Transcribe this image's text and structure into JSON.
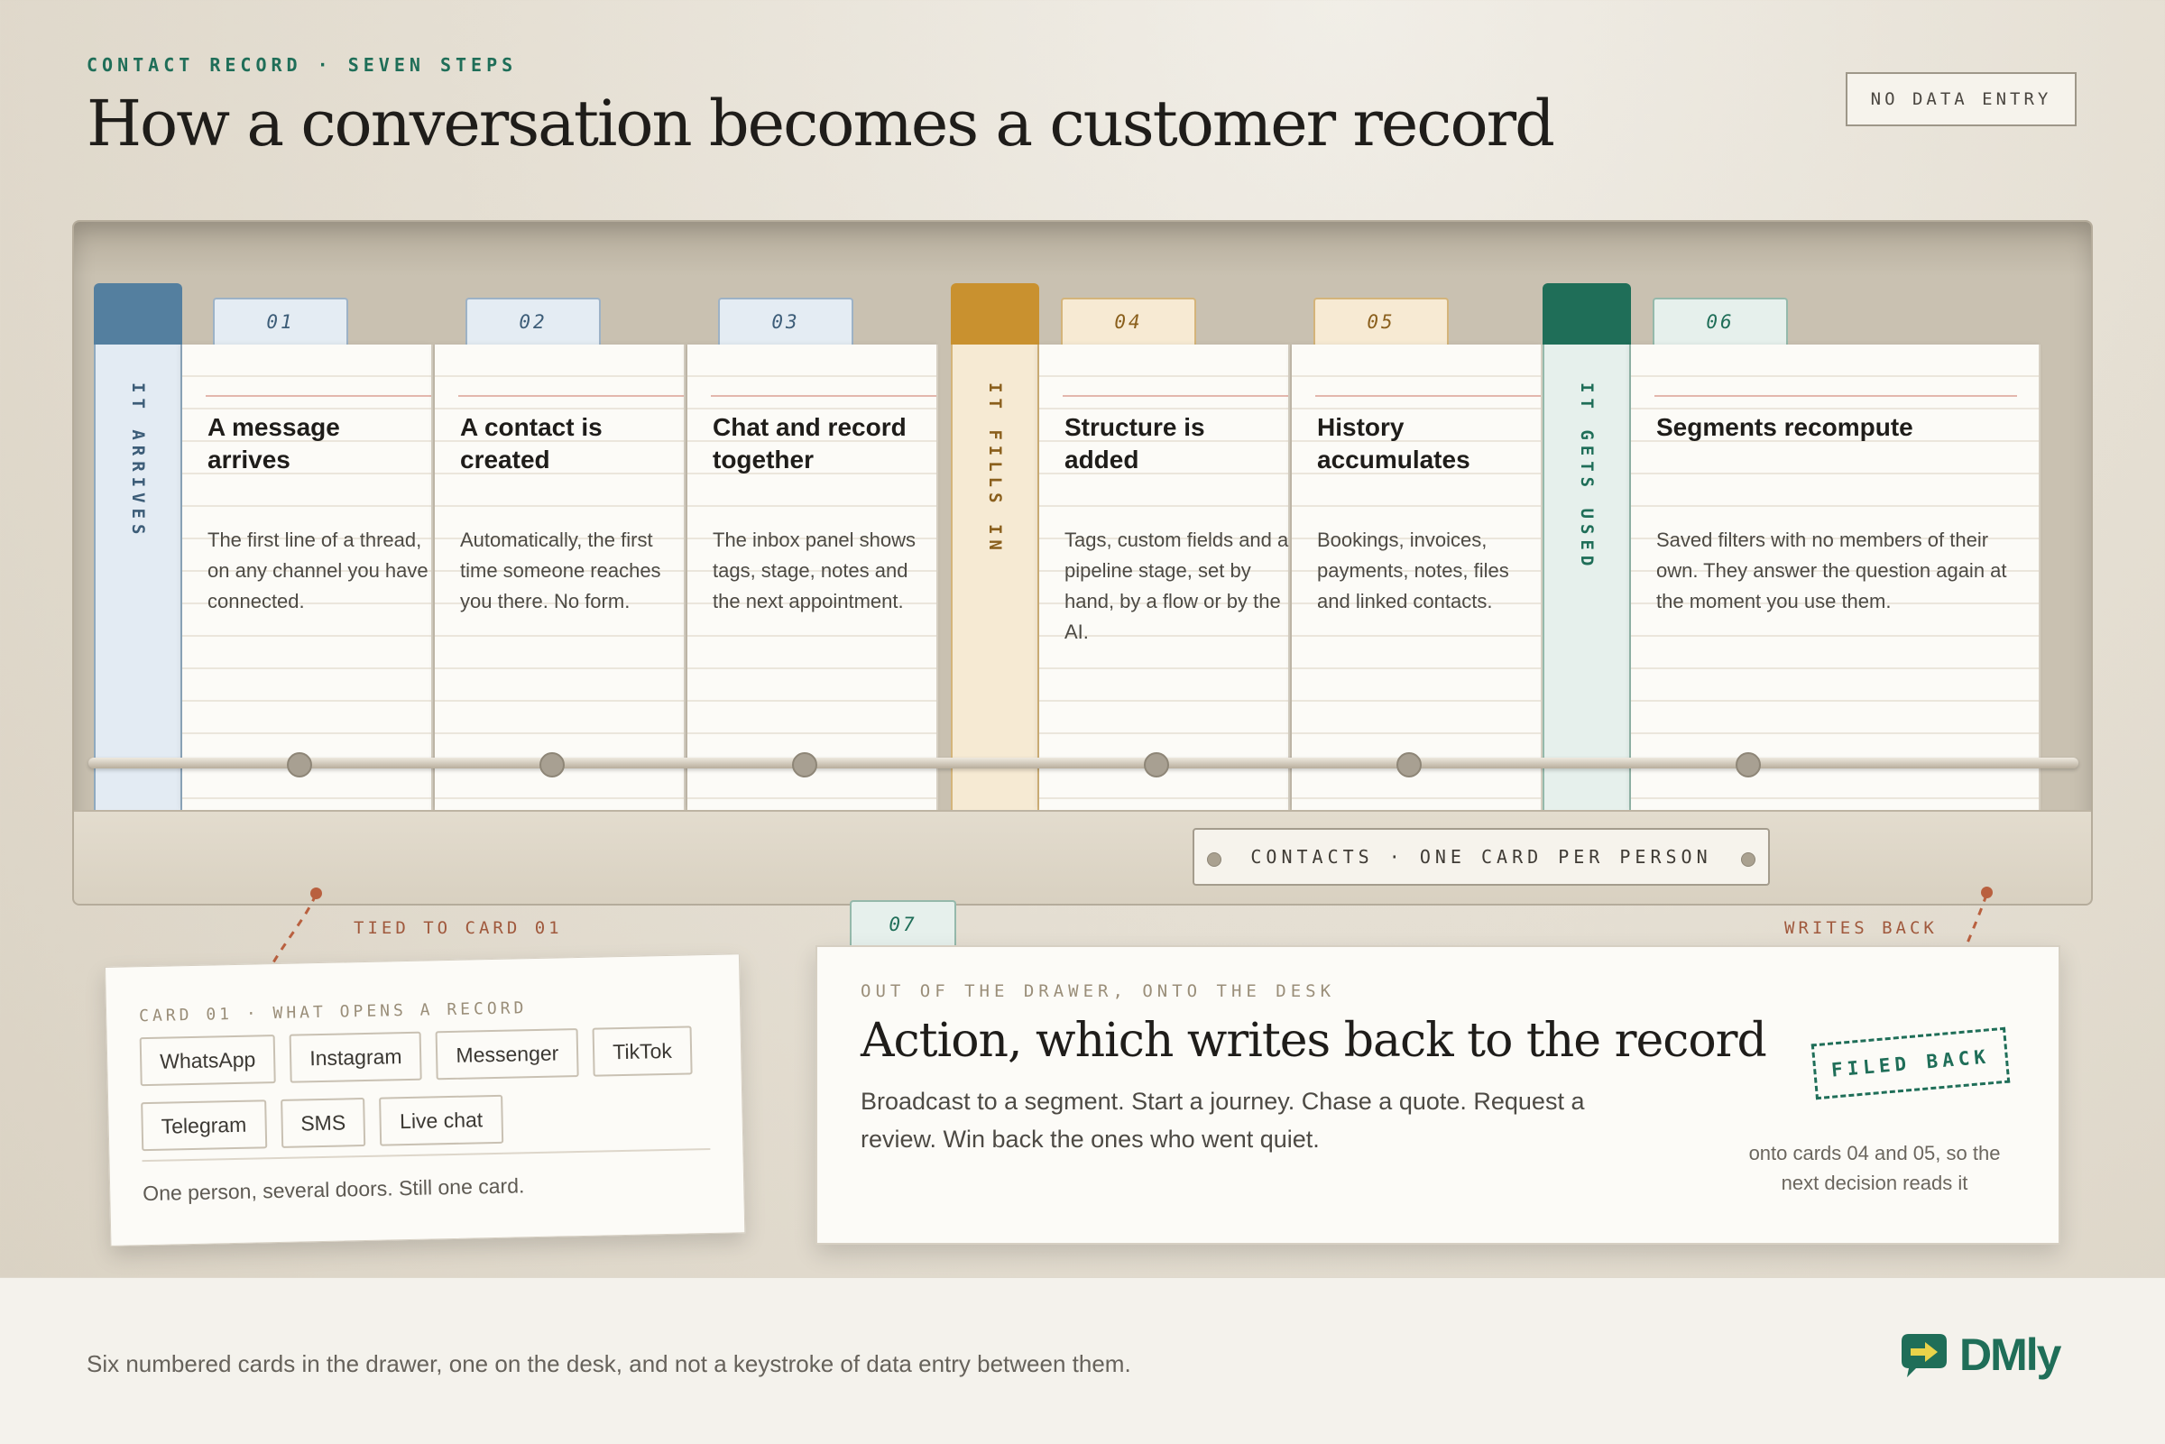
{
  "header": {
    "eyebrow": "CONTACT RECORD · SEVEN STEPS",
    "title": "How a conversation becomes a customer record",
    "badge": "NO DATA ENTRY"
  },
  "colors": {
    "blue_divider": "#547f9f",
    "gold_divider": "#c9912f",
    "green_divider": "#1f6e58",
    "accent_red": "#b9603f"
  },
  "dividers": [
    {
      "label": "IT ARRIVES",
      "color": "blue"
    },
    {
      "label": "IT FILLS IN",
      "color": "gold"
    },
    {
      "label": "IT GETS USED",
      "color": "green"
    }
  ],
  "cards": [
    {
      "num": "01",
      "title": "A message arrives",
      "body": "The first line of a thread, on any channel you have connected."
    },
    {
      "num": "02",
      "title": "A contact is created",
      "body": "Automatically, the first time someone reaches you there. No form."
    },
    {
      "num": "03",
      "title": "Chat and record together",
      "body": "The inbox panel shows tags, stage, notes and the next appointment."
    },
    {
      "num": "04",
      "title": "Structure is added",
      "body": "Tags, custom fields and a pipeline stage, set by hand, by a flow or by the AI."
    },
    {
      "num": "05",
      "title": "History accumulates",
      "body": "Bookings, invoices, payments, notes, files and linked contacts."
    },
    {
      "num": "06",
      "title": "Segments recompute",
      "body": "Saved filters with no members of their own. They answer the question again at the moment you use them."
    }
  ],
  "drawer_plate": "CONTACTS · ONE CARD PER PERSON",
  "connectors": {
    "left": "TIED TO CARD 01",
    "right": "WRITES BACK"
  },
  "note": {
    "eyebrow": "CARD 01 · WHAT OPENS A RECORD",
    "channels": [
      "WhatsApp",
      "Instagram",
      "Messenger",
      "TikTok",
      "Telegram",
      "SMS",
      "Live chat"
    ],
    "caption": "One person, several doors. Still one card."
  },
  "desk_card": {
    "num": "07",
    "eyebrow": "OUT OF THE DRAWER, ONTO THE DESK",
    "title": "Action, which writes back to the record",
    "body": "Broadcast to a segment. Start a journey. Chase a quote. Request a review. Win back the ones who went quiet.",
    "stamp": "FILED BACK",
    "stamp_caption": "onto cards 04 and 05, so the next decision reads it"
  },
  "footer": {
    "text": "Six numbered cards in the drawer, one on the desk, and not a keystroke of data entry between them.",
    "logo_text": "DMly",
    "logo_icon": "chat-arrow-logo-icon"
  }
}
